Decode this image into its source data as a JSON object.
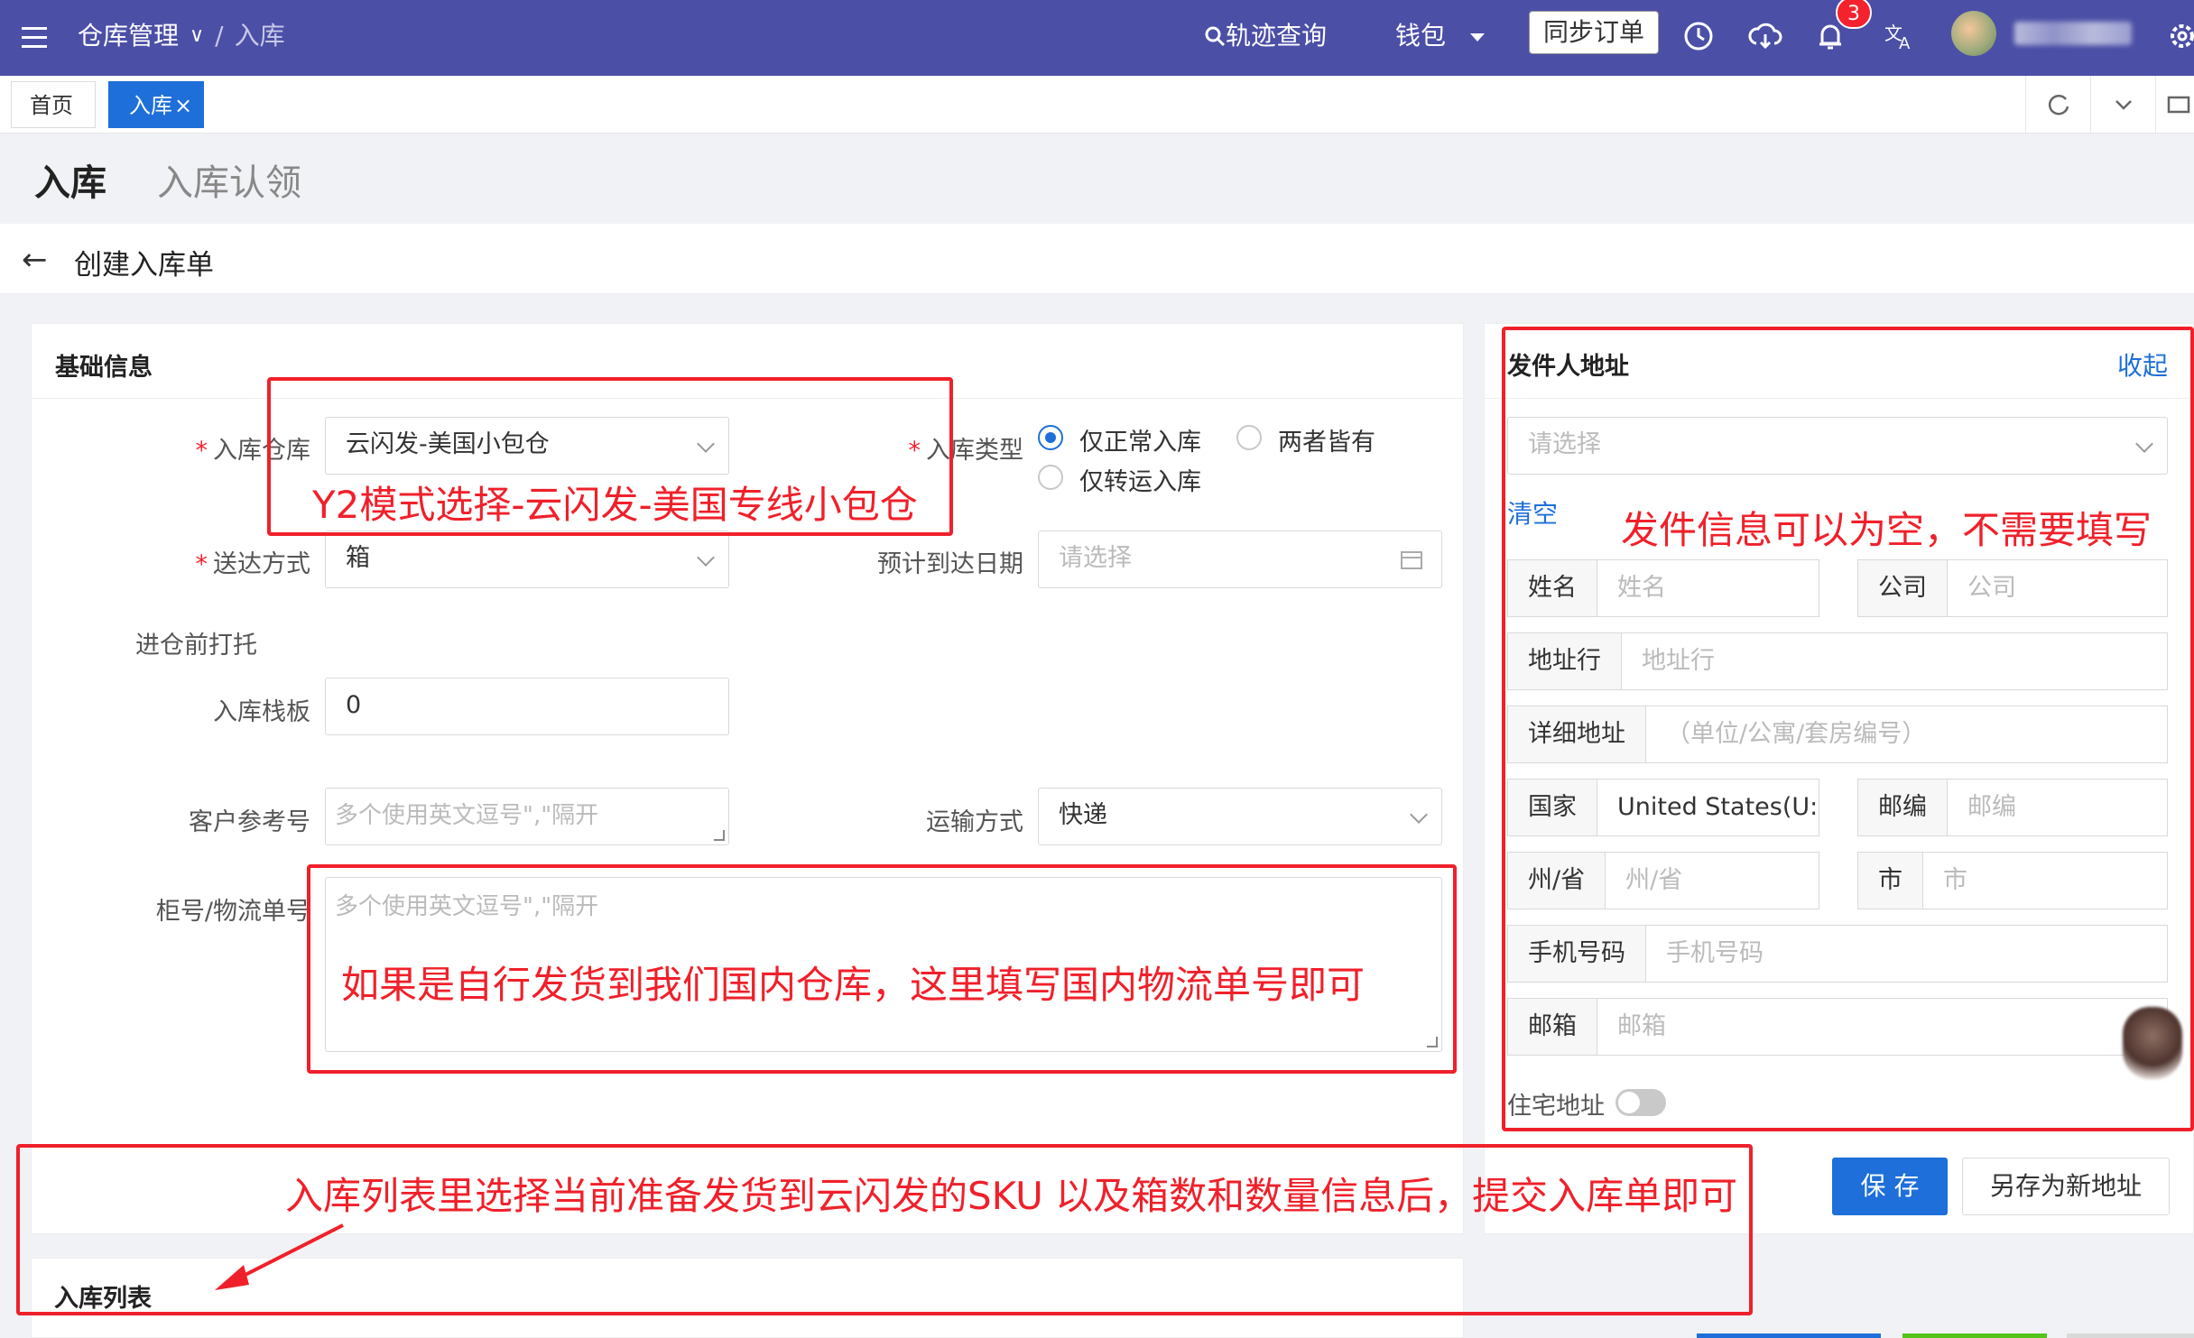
{
  "topbar": {
    "breadcrumb_root": "仓库管理",
    "breadcrumb_sep": "/",
    "breadcrumb_current": "入库",
    "track_label": "轨迹查询",
    "wallet_label": "钱包",
    "sync_label": "同步订单",
    "notification_count": "3"
  },
  "tabs": {
    "home": "首页",
    "inbound": "入库",
    "close": "×"
  },
  "page": {
    "title": "入库",
    "alt_title": "入库认领",
    "sub_title": "创建入库单",
    "back": "←"
  },
  "basic": {
    "section_title": "基础信息",
    "warehouse_label": "入库仓库",
    "warehouse_value": "云闪发-美国小包仓",
    "inbound_type_label": "入库类型",
    "radio_normal": "仅正常入库",
    "radio_both": "两者皆有",
    "radio_transfer": "仅转运入库",
    "delivery_label": "送达方式",
    "delivery_value": "箱",
    "eta_label": "预计到达日期",
    "eta_placeholder": "请选择",
    "pallet_section": "进仓前打托",
    "pallet_label": "入库栈板",
    "pallet_value": "0",
    "ref_label": "客户参考号",
    "ref_placeholder": "多个使用英文逗号\",\"隔开",
    "ship_label": "运输方式",
    "ship_value": "快递",
    "tracking_label": "柜号/物流单号",
    "tracking_placeholder": "多个使用英文逗号\",\"隔开"
  },
  "sender": {
    "section_title": "发件人地址",
    "collapse": "收起",
    "select_placeholder": "请选择",
    "clear": "清空",
    "name_label": "姓名",
    "name_placeholder": "姓名",
    "company_label": "公司",
    "company_placeholder": "公司",
    "address_label": "地址行",
    "address_placeholder": "地址行",
    "detail_label": "详细地址",
    "detail_placeholder": "（单位/公寓/套房编号）",
    "country_label": "国家",
    "country_value": "United States(U:",
    "zip_label": "邮编",
    "zip_placeholder": "邮编",
    "state_label": "州/省",
    "state_placeholder": "州/省",
    "city_label": "市",
    "city_placeholder": "市",
    "phone_label": "手机号码",
    "phone_placeholder": "手机号码",
    "email_label": "邮箱",
    "email_placeholder": "邮箱",
    "residential_label": "住宅地址",
    "save_label": "保 存",
    "save_new_label": "另存为新地址"
  },
  "list": {
    "section_title": "入库列表"
  },
  "annotations": {
    "warehouse_note": "Y2模式选择-云闪发-美国专线小包仓",
    "sender_note": "发件信息可以为空，不需要填写",
    "tracking_note": "如果是自行发货到我们国内仓库，这里填写国内物流单号即可",
    "list_note": "入库列表里选择当前准备发货到云闪发的SKU 以及箱数和数量信息后，提交入库单即可"
  },
  "colors": {
    "topbar": "#4b4fa6",
    "primary": "#1e6fd9",
    "annotation": "#f0202a"
  }
}
